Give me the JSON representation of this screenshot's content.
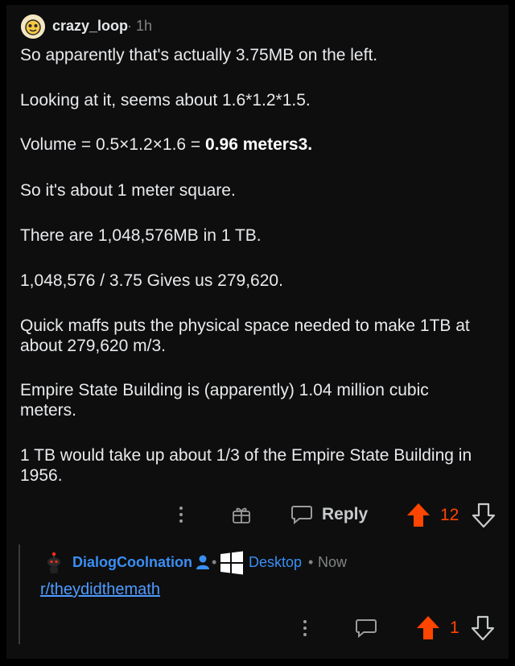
{
  "comment": {
    "username": "crazy_loop",
    "time": "1h",
    "paragraphs": {
      "p1": "So apparently that's actually 3.75MB on the left.",
      "p2": "Looking at it, seems about 1.6*1.2*1.5.",
      "p3_prefix": "Volume = 0.5×1.2×1.6 = ",
      "p3_bold": "0.96 meters3.",
      "p4": "So it's about 1 meter square.",
      "p5": "There are 1,048,576MB in 1 TB.",
      "p6": "1,048,576 / 3.75 Gives us 279,620.",
      "p7": "Quick maffs puts the physical space needed to make 1TB at about 279,620 m/3.",
      "p8": "Empire State Building is (apparently) 1.04 million cubic meters.",
      "p9": "1 TB would take up about 1/3 of the Empire State Building in 1956."
    },
    "actions": {
      "reply_label": "Reply",
      "vote_count": "12"
    }
  },
  "reply": {
    "username": "DialogCoolnation",
    "platform": "Desktop",
    "time": "Now",
    "separator": "•",
    "link_text": "r/theydidthemath",
    "vote_count": "1"
  },
  "colors": {
    "upvote": "#ff4500",
    "link": "#4f9bff",
    "username_reply": "#3a8ff5",
    "background": "#0e0e0e"
  },
  "icons": [
    "more-options-icon",
    "award-icon",
    "reply-bubble-icon",
    "upvote-arrow-icon",
    "downvote-arrow-icon",
    "mod-user-icon",
    "windows-icon",
    "snoo-avatar-icon"
  ]
}
